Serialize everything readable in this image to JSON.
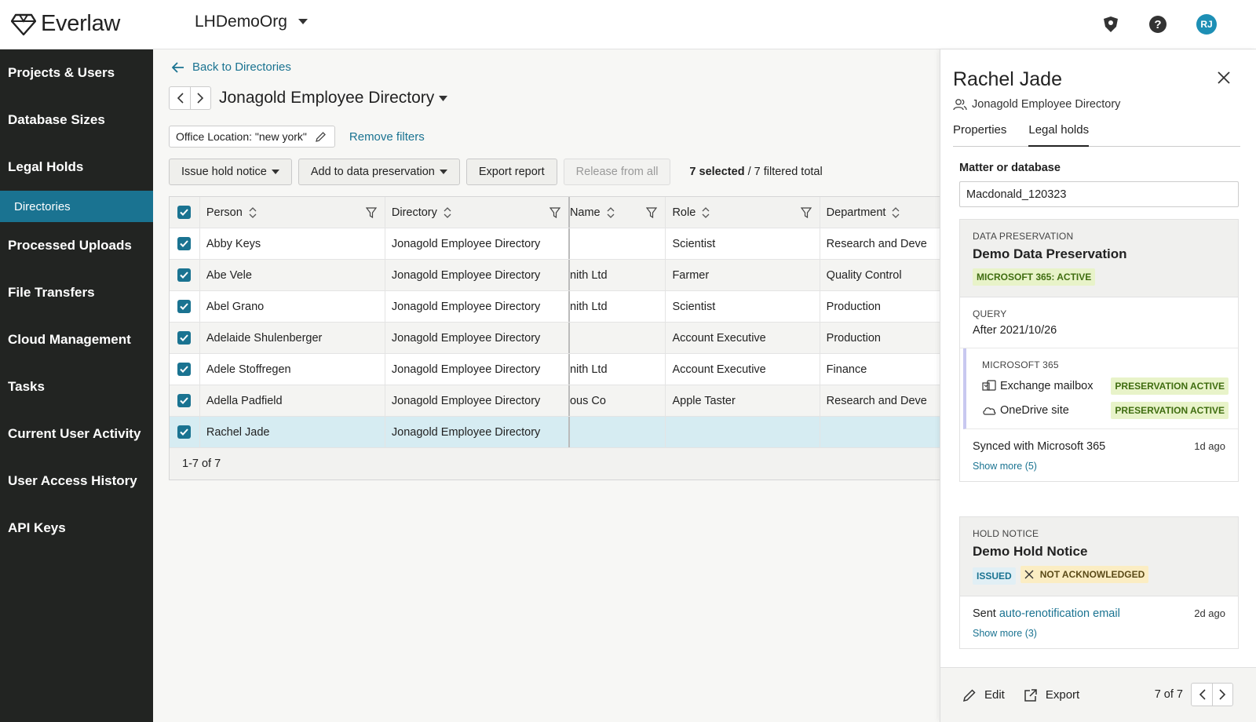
{
  "app": {
    "logo_text": "Everlaw",
    "org_name": "LHDemoOrg",
    "avatar_initials": "RJ"
  },
  "sidebar": {
    "items": [
      {
        "label": "Projects & Users"
      },
      {
        "label": "Database Sizes"
      },
      {
        "label": "Legal Holds"
      },
      {
        "label": "Directories"
      },
      {
        "label": "Processed Uploads"
      },
      {
        "label": "File Transfers"
      },
      {
        "label": "Cloud Management"
      },
      {
        "label": "Tasks"
      },
      {
        "label": "Current User Activity"
      },
      {
        "label": "User Access History"
      },
      {
        "label": "API Keys"
      }
    ]
  },
  "main": {
    "back_label": "Back to Directories",
    "directory_title": "Jonagold Employee Directory",
    "filter_label": "Office Location:",
    "filter_value": "\"new york\"",
    "remove_filters": "Remove filters",
    "toolbar": {
      "issue_hold": "Issue hold notice",
      "add_preservation": "Add to data preservation",
      "export_report": "Export report",
      "release_all": "Release from all",
      "selected_count": "7 selected",
      "filtered_total": " / 7 filtered total"
    },
    "columns": [
      "Person",
      "Directory",
      "Name",
      "Role",
      "Department"
    ],
    "rows": [
      {
        "person": "Abby Keys",
        "directory": "Jonagold Employee Directory",
        "name": "",
        "role": "Scientist",
        "department": "Research and Deve"
      },
      {
        "person": "Abe Vele",
        "directory": "Jonagold Employee Directory",
        "name": "nith Ltd",
        "role": "Farmer",
        "department": "Quality Control"
      },
      {
        "person": "Abel Grano",
        "directory": "Jonagold Employee Directory",
        "name": "nith Ltd",
        "role": "Scientist",
        "department": "Production"
      },
      {
        "person": "Adelaide Shulenberger",
        "directory": "Jonagold Employee Directory",
        "name": "",
        "role": "Account Executive",
        "department": "Production"
      },
      {
        "person": "Adele Stoffregen",
        "directory": "Jonagold Employee Directory",
        "name": "nith Ltd",
        "role": "Account Executive",
        "department": "Finance"
      },
      {
        "person": "Adella Padfield",
        "directory": "Jonagold Employee Directory",
        "name": "ous Co",
        "role": "Apple Taster",
        "department": "Research and Deve"
      },
      {
        "person": "Rachel Jade",
        "directory": "Jonagold Employee Directory",
        "name": "",
        "role": "",
        "department": ""
      }
    ],
    "pagination": "1-7 of 7"
  },
  "panel": {
    "name": "Rachel Jade",
    "directory": "Jonagold Employee Directory",
    "tabs": [
      "Properties",
      "Legal holds"
    ],
    "matter_label": "Matter or database",
    "matter_value": "Macdonald_120323",
    "preservation": {
      "kicker": "DATA PRESERVATION",
      "title": "Demo Data Preservation",
      "status": "MICROSOFT 365: ACTIVE",
      "query_label": "QUERY",
      "query_value": "After 2021/10/26",
      "m365_label": "MICROSOFT 365",
      "exchange_label": "Exchange mailbox",
      "exchange_status": "PRESERVATION ACTIVE",
      "onedrive_label": "OneDrive site",
      "onedrive_status": "PRESERVATION ACTIVE",
      "synced_label": "Synced with Microsoft 365",
      "synced_ago": "1d ago",
      "show_more": "Show more (5)"
    },
    "hold_notice": {
      "kicker": "HOLD NOTICE",
      "title": "Demo Hold Notice",
      "issued": "ISSUED",
      "ack": "NOT ACKNOWLEDGED",
      "sent_prefix": "Sent ",
      "sent_link": "auto-renotification email",
      "sent_ago": "2d ago",
      "show_more": "Show more (3)"
    },
    "footer": {
      "edit": "Edit",
      "export": "Export",
      "pager": "7 of 7"
    }
  }
}
